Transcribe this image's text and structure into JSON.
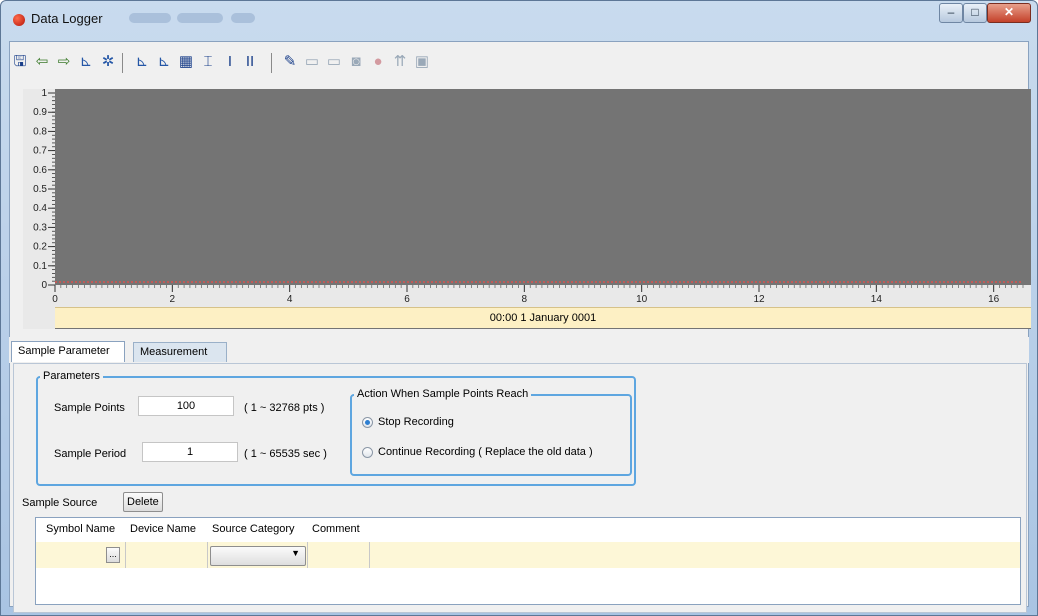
{
  "window": {
    "title": "Data Logger",
    "controls": {
      "minimize": "–",
      "maximize": "□",
      "close": "✕"
    }
  },
  "toolbar": {
    "icons": [
      {
        "name": "save-icon",
        "glyph": "🖫",
        "color": "#1a3f8a",
        "enabled": true
      },
      {
        "name": "import-icon",
        "glyph": "⇦",
        "color": "#3b7a2a",
        "enabled": true
      },
      {
        "name": "export-icon",
        "glyph": "⇨",
        "color": "#3b7a2a",
        "enabled": true
      },
      {
        "name": "chart-add-icon",
        "glyph": "⊾",
        "color": "#2456a6",
        "enabled": true
      },
      {
        "name": "settings-gear-icon",
        "glyph": "✲",
        "color": "#2456a6",
        "enabled": true
      },
      {
        "name": "chart-line-icon",
        "glyph": "⊾",
        "color": "#2456a6",
        "enabled": true
      },
      {
        "name": "chart-trend-icon",
        "glyph": "⊾",
        "color": "#2456a6",
        "enabled": true
      },
      {
        "name": "table-grid-icon",
        "glyph": "▦",
        "color": "#1a3f8a",
        "enabled": true
      },
      {
        "name": "fit-horizontal-icon",
        "glyph": "⌶",
        "color": "#1a3f8a",
        "enabled": true
      },
      {
        "name": "cursor-1-icon",
        "glyph": "I",
        "color": "#1a3f8a",
        "enabled": true
      },
      {
        "name": "cursor-2-icon",
        "glyph": "II",
        "color": "#1a3f8a",
        "enabled": true
      },
      {
        "name": "pen-icon",
        "glyph": "✎",
        "color": "#1a3f8a",
        "enabled": true
      },
      {
        "name": "monitor-icon",
        "glyph": "▭",
        "color": "#9aa9b8",
        "enabled": false
      },
      {
        "name": "monitor-data-icon",
        "glyph": "▭",
        "color": "#9aa9b8",
        "enabled": false
      },
      {
        "name": "record-stop-icon",
        "glyph": "◙",
        "color": "#9aa9b8",
        "enabled": false
      },
      {
        "name": "record-icon",
        "glyph": "●",
        "color": "#d39aa0",
        "enabled": false
      },
      {
        "name": "upload-icon",
        "glyph": "⇈",
        "color": "#9aa9b8",
        "enabled": false
      },
      {
        "name": "clear-icon",
        "glyph": "▣",
        "color": "#9aa9b8",
        "enabled": false
      }
    ]
  },
  "chart_data": {
    "type": "line",
    "series": [],
    "y_ticks": [
      "1",
      "0.9",
      "0.8",
      "0.7",
      "0.6",
      "0.5",
      "0.4",
      "0.3",
      "0.2",
      "0.1",
      "0"
    ],
    "x_ticks": [
      "0",
      "2",
      "4",
      "6",
      "8",
      "10",
      "12",
      "14",
      "16"
    ],
    "xlim": [
      0,
      16.5
    ],
    "ylim": [
      0,
      1
    ],
    "baseline_color": "#d9534f",
    "background": "#747474",
    "grid": false
  },
  "date_label": "00:00 1 January 0001",
  "tabs": [
    {
      "label": "Sample Parameter",
      "active": true
    },
    {
      "label": "Measurement",
      "active": false
    }
  ],
  "parameters": {
    "group_title": "Parameters",
    "sample_points_label": "Sample Points",
    "sample_points_value": "100",
    "sample_points_range": "( 1 ~ 32768 pts )",
    "sample_period_label": "Sample Period",
    "sample_period_value": "1",
    "sample_period_range": "( 1 ~ 65535 sec )"
  },
  "action": {
    "group_title": "Action When Sample Points Reach",
    "option_stop": "Stop Recording",
    "option_continue": "Continue Recording ( Replace the old data )",
    "selected": "stop"
  },
  "sample_source": {
    "label": "Sample Source",
    "delete_label": "Delete",
    "columns": [
      "Symbol Name",
      "Device Name",
      "Source Category",
      "Comment"
    ],
    "browse_label": "...",
    "category_value": ""
  }
}
